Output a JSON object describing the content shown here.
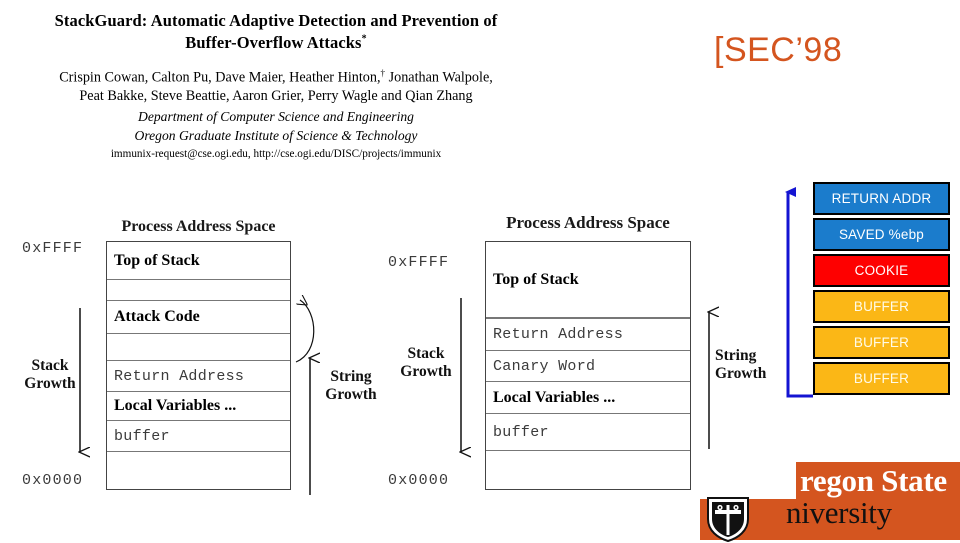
{
  "paper": {
    "title_line1": "StackGuard:  Automatic Adaptive Detection and Prevention of",
    "title_line2": "Buffer-Overflow Attacks",
    "title_footnote_marker": "*",
    "authors_line1": "Crispin Cowan, Calton Pu, Dave Maier, Heather Hinton,",
    "authors_footnote_marker": "†",
    "authors_line1_cont": " Jonathan Walpole,",
    "authors_line2": "Peat Bakke, Steve Beattie, Aaron Grier, Perry Wagle and Qian Zhang",
    "affiliation_line1": "Department of Computer Science and Engineering",
    "affiliation_line2": "Oregon Graduate Institute of Science & Technology",
    "contact": "immunix-request@cse.ogi.edu, http://cse.ogi.edu/DISC/projects/immunix"
  },
  "venue": {
    "label": "[SEC’98",
    "color": "#d4551f"
  },
  "left_diagram": {
    "caption": "Process Address Space",
    "addr_high": "0xFFFF",
    "addr_low": "0x0000",
    "stack_growth_label_line1": "Stack",
    "stack_growth_label_line2": "Growth",
    "string_growth_label_line1": "String",
    "string_growth_label_line2": "Growth",
    "rows": [
      {
        "text": "Top of Stack",
        "style": "serif-b"
      },
      {
        "text": "",
        "style": "serif-n"
      },
      {
        "text": "Attack Code",
        "style": "serif-b"
      },
      {
        "text": "",
        "style": "serif-n"
      },
      {
        "text": "Return Address",
        "style": "mono"
      },
      {
        "text": "Local Variables ...",
        "style": "serif-b"
      },
      {
        "text": "buffer",
        "style": "mono"
      },
      {
        "text": "",
        "style": "serif-n"
      }
    ]
  },
  "right_diagram": {
    "caption": "Process Address Space",
    "addr_high": "0xFFFF",
    "addr_low": "0x0000",
    "stack_growth_label_line1": "Stack",
    "stack_growth_label_line2": "Growth",
    "string_growth_label_line1": "String",
    "string_growth_label_line2": "Growth",
    "rows": [
      {
        "text": "Top of Stack",
        "style": "serif-b"
      },
      {
        "text": "",
        "style": "serif-n"
      },
      {
        "text": "Return Address",
        "style": "mono"
      },
      {
        "text": "Canary Word",
        "style": "mono"
      },
      {
        "text": "Local Variables ...",
        "style": "serif-b"
      },
      {
        "text": "buffer",
        "style": "mono"
      },
      {
        "text": "",
        "style": "serif-n"
      }
    ]
  },
  "cookie_stack": {
    "blocks": [
      {
        "label": "RETURN ADDR",
        "color": "#1b7ccc",
        "text_color": "#ffffff"
      },
      {
        "label": "SAVED %ebp",
        "color": "#1b7ccc",
        "text_color": "#ffffff"
      },
      {
        "label": "COOKIE",
        "color": "#fe0000",
        "text_color": "#ffffff"
      },
      {
        "label": "BUFFER",
        "color": "#fbb716",
        "text_color": "#fffbe8"
      },
      {
        "label": "BUFFER",
        "color": "#fbb716",
        "text_color": "#fffbe8"
      },
      {
        "label": "BUFFER",
        "color": "#fbb716",
        "text_color": "#fffbe8"
      }
    ],
    "arrow_color": "#1414d2"
  },
  "branding": {
    "state_word": "regon State",
    "university_word": "niversity",
    "brand_color": "#d4551f"
  }
}
